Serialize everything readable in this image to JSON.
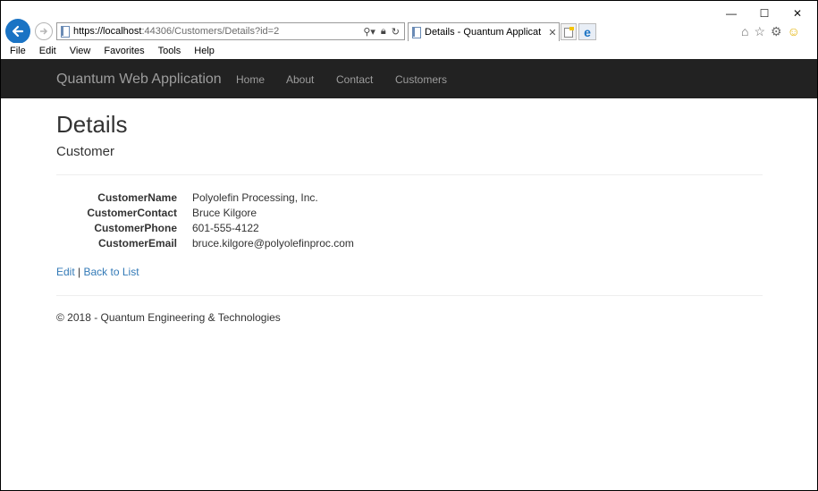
{
  "browser": {
    "url_host": "https://localhost",
    "url_rest": ":44306/Customers/Details?id=2",
    "tab_title": "Details - Quantum Applicat",
    "menu": [
      "File",
      "Edit",
      "View",
      "Favorites",
      "Tools",
      "Help"
    ],
    "accent": "#1a73c4"
  },
  "nav": {
    "brand": "Quantum Web Application",
    "links": [
      "Home",
      "About",
      "Contact",
      "Customers"
    ]
  },
  "page": {
    "title": "Details",
    "subtitle": "Customer",
    "fields": [
      {
        "label": "CustomerName",
        "value": "Polyolefin Processing, Inc."
      },
      {
        "label": "CustomerContact",
        "value": "Bruce Kilgore"
      },
      {
        "label": "CustomerPhone",
        "value": "601-555-4122"
      },
      {
        "label": "CustomerEmail",
        "value": "bruce.kilgore@polyolefinproc.com"
      }
    ],
    "edit_label": "Edit",
    "separator": "|",
    "back_label": "Back to List",
    "footer": "© 2018 - Quantum Engineering & Technologies"
  }
}
